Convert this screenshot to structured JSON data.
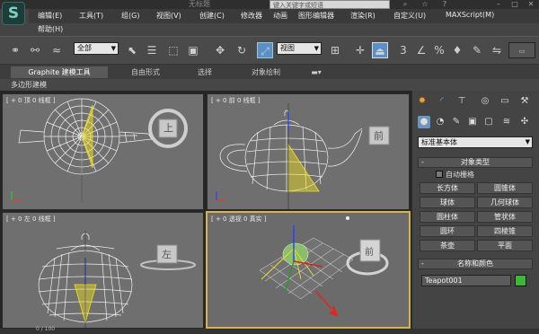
{
  "window": {
    "title": "无标题",
    "search_placeholder": "键入关键字或短语"
  },
  "menu": [
    "编辑(E)",
    "工具(T)",
    "组(G)",
    "视图(V)",
    "创建(C)",
    "修改器",
    "动画",
    "图形编辑器",
    "渲染(R)",
    "自定义(U)",
    "MAXScript(M)"
  ],
  "menu2": [
    "帮助(H)"
  ],
  "toolbar": {
    "selection_filter": "全部",
    "reference_coord": "视图"
  },
  "ribbon": {
    "tabs": [
      "Graphite 建模工具",
      "自由形式",
      "选择",
      "对象绘制"
    ],
    "active_tab": 0,
    "sub_label": "多边形建模"
  },
  "viewports": {
    "top": "[ + 0 顶 0 线框 ]",
    "front": "[ + 0 前 0 线框 ]",
    "left": "[ + 0 左 0 线框 ]",
    "perspective": "[ + 0 透视 0 真实 ]",
    "cube_top": "上",
    "cube_front": "前",
    "cube_left": "左",
    "cube_persp_front": "前"
  },
  "command_panel": {
    "category": "标准基本体",
    "object_type_title": "对象类型",
    "autogrid_label": "自动栅格",
    "primitives": [
      "长方体",
      "圆锥体",
      "球体",
      "几何球体",
      "圆柱体",
      "管状体",
      "圆环",
      "四棱锥",
      "茶壶",
      "平面"
    ],
    "name_color_title": "名称和颜色",
    "object_name": "Teapot001",
    "object_color": "#3cb832"
  },
  "status": {
    "frame": "0 / 100"
  },
  "colors": {
    "wire_white": "#f2f2f2",
    "selection_yellow": "#f2e21a",
    "active_border": "#d6b44a",
    "annotation_arrow": "#e3251f"
  }
}
